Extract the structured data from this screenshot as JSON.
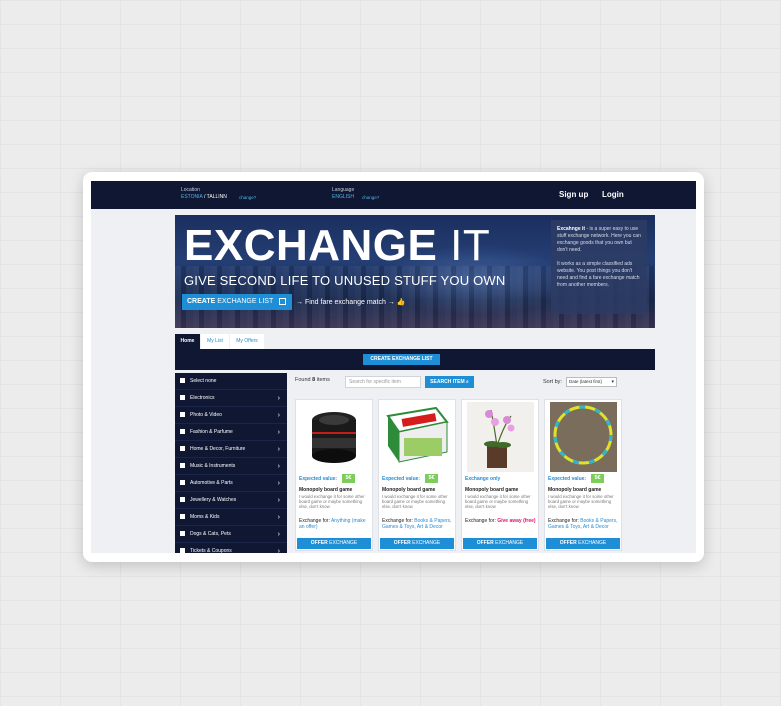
{
  "topbar": {
    "location_label": "Location",
    "location_country": "ESTONIA",
    "location_sep": " / ",
    "location_city": "TALLINN",
    "location_change": "change?",
    "language_label": "Language",
    "language_value": "ENGLISH",
    "language_change": "change?",
    "signup": "Sign up",
    "login": "Login"
  },
  "hero": {
    "title_bold": "EXCHANGE",
    "title_light": " IT",
    "subtitle": "GIVE SECOND LIFE TO UNUSED STUFF YOU OWN",
    "button_bold": "CREATE",
    "button_rest": " EXCHANGE LIST",
    "match_text": "→  Find fare exchange match  →",
    "info_brand": "Excahnge it",
    "info_p1": " - is a super easy to use stuff exchange network. Here you can exchange goods that you own but don't need.",
    "info_p2": "It works as a simple classified ads website. You post things you don't need and find a fare exchange match from another members."
  },
  "tabs": [
    "Home",
    "My List",
    "My Offers"
  ],
  "bar_button": "CREATE  EXCHANGE LIST",
  "sidebar": {
    "items": [
      {
        "label": "Select none",
        "chevron": ""
      },
      {
        "label": "Electronics",
        "chevron": "›"
      },
      {
        "label": "Photo & Video",
        "chevron": "›"
      },
      {
        "label": "Fashion & Parfume",
        "chevron": "›"
      },
      {
        "label": "Home & Decor, Furniture",
        "chevron": "›"
      },
      {
        "label": "Music & Instruments",
        "chevron": "›"
      },
      {
        "label": "Automotive & Parts",
        "chevron": "›"
      },
      {
        "label": "Jewellery & Watches",
        "chevron": "›"
      },
      {
        "label": "Moms & Kids",
        "chevron": "›"
      },
      {
        "label": "Dogs & Cats, Pets",
        "chevron": "›"
      },
      {
        "label": "Tickets & Coupons",
        "chevron": "›"
      }
    ]
  },
  "results": {
    "found_prefix": "Found ",
    "found_count": "8",
    "found_suffix": " items",
    "search_placeholder": "Search for specific item",
    "search_button": "SEARCH ITEM",
    "sort_label": "Sort by:",
    "sort_value": "Date (latest first)"
  },
  "cards": [
    {
      "image": "camera-lens",
      "label": "Expected value:",
      "price": "5€",
      "name": "Monopoly board game",
      "desc": "I would exchange it for some other board game or maybe something else, don't know",
      "ex_label": "Exchange for: ",
      "ex_value": "Anything (make an offer)",
      "ex_red": false,
      "offer_bold": "OFFER",
      "offer_rest": " EXCHANGE"
    },
    {
      "image": "monopoly-box",
      "label": "Expected value:",
      "price": "5€",
      "name": "Monopoly board game",
      "desc": "I would exchange it for some other board game or maybe something else, don't know",
      "ex_label": "Exchange for: ",
      "ex_value": "Books & Papers, Games & Toys, Art & Decor",
      "ex_red": false,
      "offer_bold": "OFFER",
      "offer_rest": " EXCHANGE"
    },
    {
      "image": "orchid-plant",
      "label": "Exchange only",
      "price": "",
      "name": "Monopoly board game",
      "desc": "I would exchange it for some other board game or maybe something else, don't know",
      "ex_label": "Exchange for: ",
      "ex_value": "Give away (free)",
      "ex_red": true,
      "offer_bold": "OFFER",
      "offer_rest": " EXCHANGE"
    },
    {
      "image": "hula-hoop",
      "label": "Expected value:",
      "price": "5€",
      "name": "Monopoly board game",
      "desc": "I would exchange it for some other board game or maybe something else, don't know",
      "ex_label": "Exchange for: ",
      "ex_value": "Books & Papers, Games & Toys, Art & Decor",
      "ex_red": false,
      "offer_bold": "OFFER",
      "offer_rest": " EXCHANGE"
    }
  ]
}
